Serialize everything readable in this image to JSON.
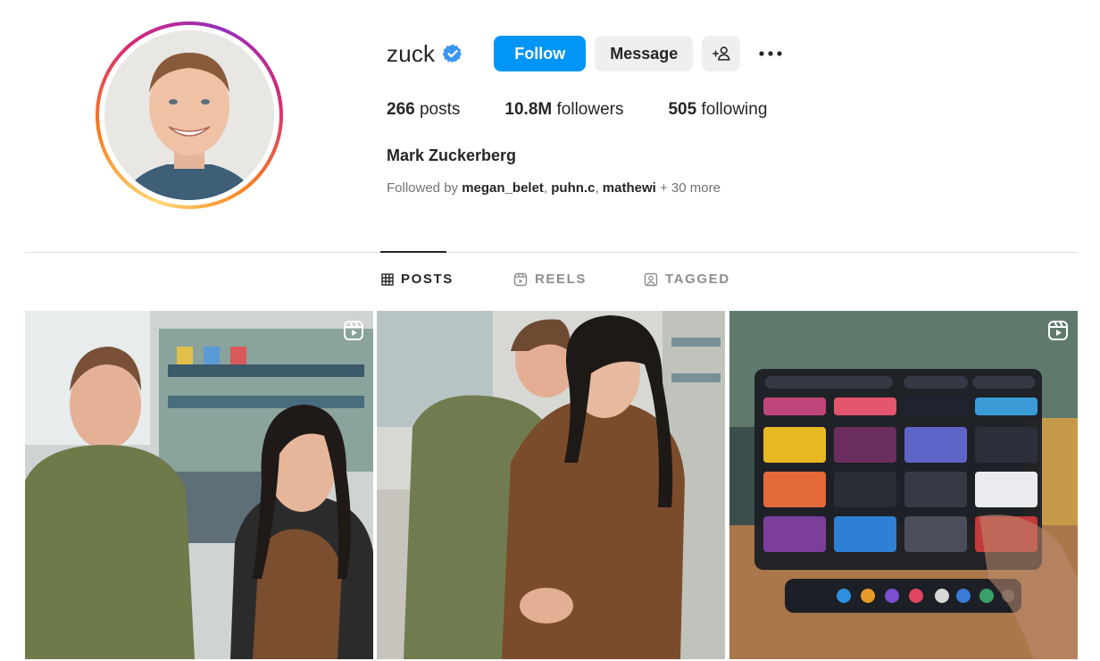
{
  "profile": {
    "username": "zuck",
    "full_name": "Mark Zuckerberg",
    "verified": true
  },
  "actions": {
    "follow_label": "Follow",
    "message_label": "Message",
    "add_user_icon": "add-user-icon",
    "more_icon": "more-options-icon"
  },
  "stats": {
    "posts_count": "266",
    "posts_label": "posts",
    "followers_count": "10.8M",
    "followers_label": "followers",
    "following_count": "505",
    "following_label": "following"
  },
  "followed_by": {
    "prefix": "Followed by",
    "users": [
      "megan_belet",
      "puhn.c",
      "mathewi"
    ],
    "suffix": "+ 30 more"
  },
  "tabs": [
    {
      "label": "POSTS",
      "icon": "grid-icon",
      "active": true
    },
    {
      "label": "REELS",
      "icon": "reels-icon",
      "active": false
    },
    {
      "label": "TAGGED",
      "icon": "tagged-icon",
      "active": false
    }
  ],
  "posts": [
    {
      "type": "reel"
    },
    {
      "type": "photo"
    },
    {
      "type": "reel"
    }
  ],
  "colors": {
    "accent": "#0095f6",
    "button_gray": "#efefef",
    "verified": "#0095f6"
  }
}
